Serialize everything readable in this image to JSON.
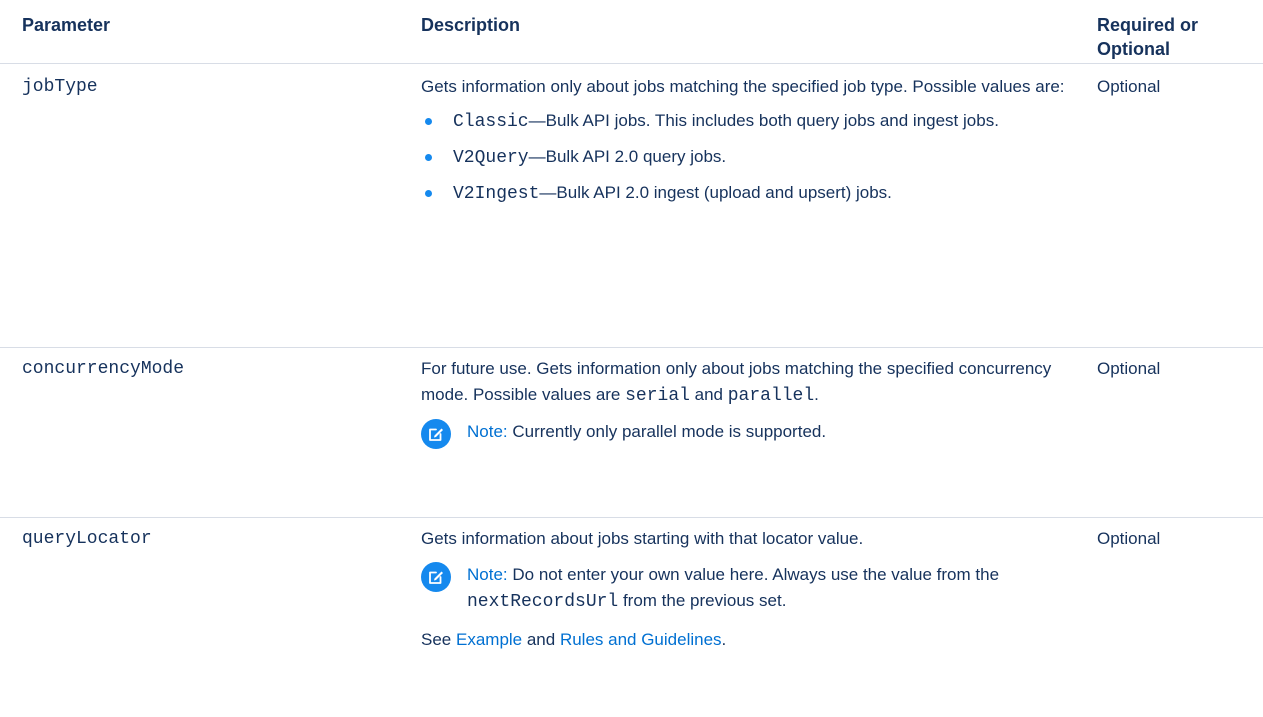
{
  "table": {
    "headers": {
      "parameter": "Parameter",
      "description": "Description",
      "required_line1": "Required or",
      "required_line2": "Optional"
    },
    "rows": [
      {
        "name": "jobType",
        "desc_intro": "Gets information only about jobs matching the specified job type. Possible values are:",
        "values": [
          {
            "code": "Classic",
            "text": "—Bulk API jobs. This includes both query jobs and ingest jobs."
          },
          {
            "code": "V2Query",
            "text": "—Bulk API 2.0 query jobs."
          },
          {
            "code": "V2Ingest",
            "text": "—Bulk API 2.0 ingest (upload and upsert) jobs."
          }
        ],
        "required": "Optional"
      },
      {
        "name": "concurrencyMode",
        "desc_before": "For future use. Gets information only about jobs matching the specified concurrency mode. Possible values are ",
        "value_1": "serial",
        "desc_and": " and ",
        "value_2": "parallel",
        "desc_end": ".",
        "note_label": "Note:",
        "note_text": " Currently only parallel mode is supported.",
        "required": "Optional"
      },
      {
        "name": "queryLocator",
        "desc": "Gets information about jobs starting with that locator value.",
        "note_label": "Note:",
        "note_text_before": " Do not enter your own value here. Always use the value from the ",
        "note_code": "nextRecordsUrl",
        "note_text_after": " from the previous set.",
        "see_prefix": "See ",
        "link_example": "Example",
        "see_and": " and ",
        "link_rules": "Rules and Guidelines",
        "see_end": ".",
        "required": "Optional"
      }
    ]
  },
  "colors": {
    "text": "#16325c",
    "accent": "#1589ee",
    "link": "#0070d2",
    "divider": "#d8dde6"
  },
  "icons": {
    "note": "edit-note-icon",
    "bullet": "bullet-dot-icon"
  }
}
